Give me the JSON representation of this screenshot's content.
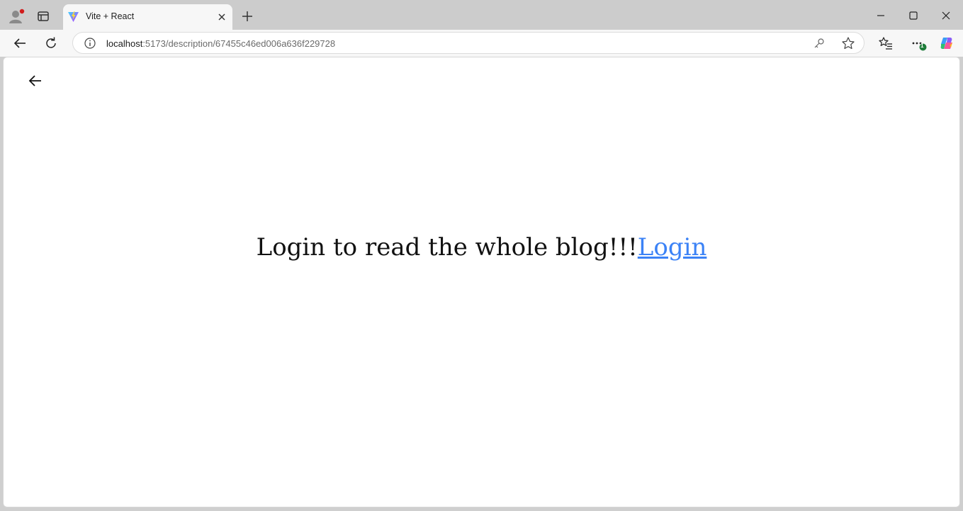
{
  "browser": {
    "tab": {
      "title": "Vite + React"
    },
    "address": {
      "host": "localhost",
      "path": ":5173/description/67455c46ed006a636f229728"
    },
    "icons": {
      "profile": "profile-avatar-icon",
      "tab_actions": "tab-actions-icon",
      "favicon": "vite-logo-icon",
      "close_tab": "close-icon",
      "new_tab": "plus-icon",
      "back": "arrow-left-icon",
      "reload": "reload-icon",
      "site_info": "info-icon",
      "password": "key-icon",
      "favorite": "star-icon",
      "favorites": "favorites-list-icon",
      "more": "ellipsis-icon",
      "copilot": "copilot-icon"
    },
    "more_badge": "1"
  },
  "page": {
    "message": "Login to read the whole blog!!!",
    "login_link": "Login",
    "back_icon": "arrow-left-icon"
  },
  "colors": {
    "link": "#3b82f6",
    "tabstrip": "#cccccc",
    "toolbar": "#f7f7f7"
  }
}
